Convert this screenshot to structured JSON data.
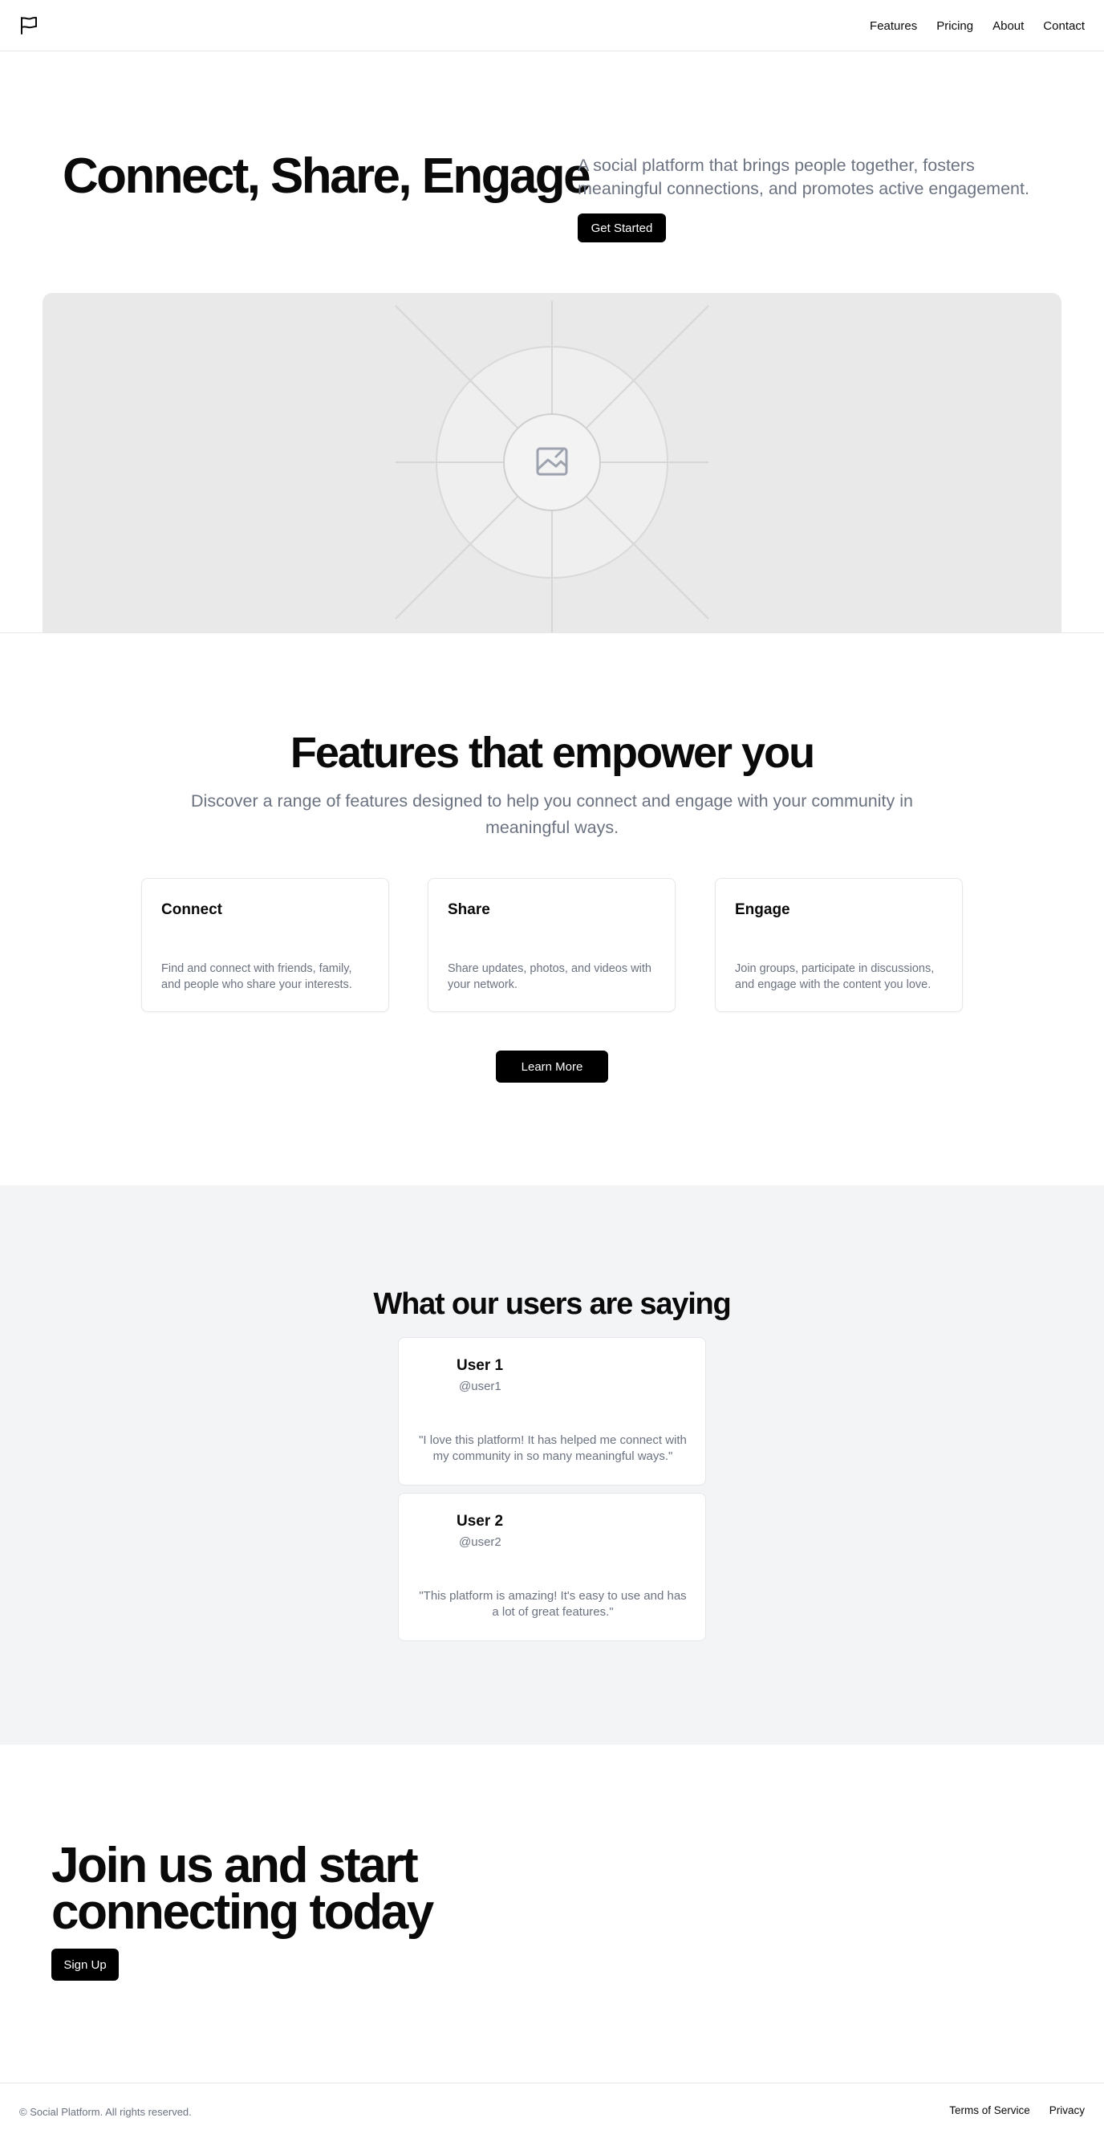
{
  "header": {
    "logo_icon": "flag-icon",
    "nav": [
      {
        "label": "Features"
      },
      {
        "label": "Pricing"
      },
      {
        "label": "About"
      },
      {
        "label": "Contact"
      }
    ]
  },
  "hero": {
    "title": "Connect, Share, Engage",
    "subtitle": "A social platform that brings people together, fosters meaningful connections, and promotes active engagement.",
    "cta_label": "Get Started",
    "image_icon": "image-placeholder-icon"
  },
  "features": {
    "title": "Features that empower you",
    "subtitle": "Discover a range of features designed to help you connect and engage with your community in meaningful ways.",
    "cards": [
      {
        "title": "Connect",
        "description": "Find and connect with friends, family, and people who share your interests."
      },
      {
        "title": "Share",
        "description": "Share updates, photos, and videos with your network."
      },
      {
        "title": "Engage",
        "description": "Join groups, participate in discussions, and engage with the content you love."
      }
    ],
    "cta_label": "Learn More"
  },
  "testimonials": {
    "title": "What our users are saying",
    "items": [
      {
        "name": "User 1",
        "handle": "@user1",
        "quote": "\"I love this platform! It has helped me connect with my community in so many meaningful ways.\""
      },
      {
        "name": "User 2",
        "handle": "@user2",
        "quote": "\"This platform is amazing! It's easy to use and has a lot of great features.\""
      }
    ]
  },
  "cta": {
    "title": "Join us and start connecting today",
    "button_label": "Sign Up"
  },
  "footer": {
    "copyright": "© Social Platform. All rights reserved.",
    "links": [
      {
        "label": "Terms of Service"
      },
      {
        "label": "Privacy"
      }
    ]
  },
  "colors": {
    "primary": "#000000",
    "muted_text": "#6b7280",
    "border": "#e5e7eb",
    "section_bg": "#f3f4f6",
    "placeholder_bg": "#e9e9e9"
  }
}
